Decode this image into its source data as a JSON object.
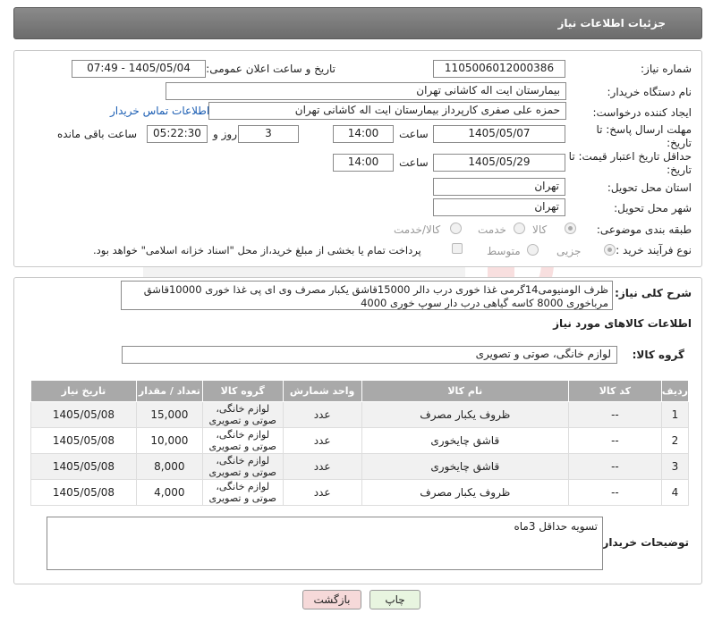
{
  "header": {
    "title": "جزئیات اطلاعات نیاز"
  },
  "form": {
    "need_number_label": "شماره نیاز:",
    "need_number_value": "1105006012000386",
    "announce_datetime_label": "تاریخ و ساعت اعلان عمومی:",
    "announce_datetime_value": "1405/05/04 - 07:49",
    "buyer_org_label": "نام دستگاه خریدار:",
    "buyer_org_value": "بیمارستان ایت اله کاشانی تهران",
    "requester_label": "ایجاد کننده درخواست:",
    "requester_value": "حمزه علی صفری کارپرداز بیمارستان ایت اله کاشانی تهران",
    "buyer_contact_link": "اطلاعات تماس خریدار",
    "deadline_label": "مهلت ارسال پاسخ: تا تاریخ:",
    "deadline_date": "1405/05/07",
    "time_label": "ساعت",
    "deadline_time": "14:00",
    "days_value": "3",
    "days_label": "روز و",
    "remaining_time": "05:22:30",
    "remaining_label": "ساعت باقی مانده",
    "price_validity_label": "حداقل تاریخ اعتبار قیمت: تا تاریخ:",
    "price_validity_date": "1405/05/29",
    "price_validity_time": "14:00",
    "delivery_province_label": "استان محل تحویل:",
    "delivery_province_value": "تهران",
    "delivery_city_label": "شهر محل تحویل:",
    "delivery_city_value": "تهران",
    "category_label": "طبقه بندی موضوعی:",
    "category_options": [
      "کالا",
      "خدمت",
      "کالا/خدمت"
    ],
    "category_selected": "کالا",
    "process_label": "نوع فرآیند خرید :",
    "process_options": [
      "جزیی",
      "متوسط"
    ],
    "process_selected": "جزیی",
    "payment_note": "پرداخت تمام یا بخشی از مبلغ خرید،از محل \"اسناد خزانه اسلامی\" خواهد بود."
  },
  "description": {
    "label": "شرح کلی نیاز:",
    "text": "ظرف الومنیومی14گرمی غذا خوری درب دالر 15000قاشق یکبار مصرف وی ای پی غذا خوری 10000قاشق مرباخوری 8000 کاسه گیاهی درب دار سوپ خوری 4000"
  },
  "goods": {
    "section_title": "اطلاعات کالاهای مورد نیاز",
    "group_label": "گروه کالا:",
    "group_value": "لوازم خانگی، صوتی و تصویری",
    "columns": [
      "ردیف",
      "کد کالا",
      "نام کالا",
      "واحد شمارش",
      "گروه کالا",
      "تعداد / مقدار",
      "تاریخ نیاز"
    ],
    "rows": [
      {
        "row": "1",
        "code": "--",
        "name": "ظروف یکبار مصرف",
        "unit": "عدد",
        "group": "لوازم خانگی، صوتی و تصویری",
        "qty": "15,000",
        "date": "1405/05/08"
      },
      {
        "row": "2",
        "code": "--",
        "name": "قاشق چایخوری",
        "unit": "عدد",
        "group": "لوازم خانگی، صوتی و تصویری",
        "qty": "10,000",
        "date": "1405/05/08"
      },
      {
        "row": "3",
        "code": "--",
        "name": "قاشق چایخوری",
        "unit": "عدد",
        "group": "لوازم خانگی، صوتی و تصویری",
        "qty": "8,000",
        "date": "1405/05/08"
      },
      {
        "row": "4",
        "code": "--",
        "name": "ظروف یکبار مصرف",
        "unit": "عدد",
        "group": "لوازم خانگی، صوتی و تصویری",
        "qty": "4,000",
        "date": "1405/05/08"
      }
    ]
  },
  "buyer_notes": {
    "label": "توضیحات خریدار:",
    "text": "تسویه حداقل 3ماه"
  },
  "buttons": {
    "print": "چاپ",
    "back": "بازگشت"
  },
  "colors": {
    "header_bg": "#777777",
    "table_header_bg": "#a9a9a9",
    "link": "#1a5db3",
    "back_button_bg": "#f6d9d9",
    "print_button_bg": "#e8f5e0"
  }
}
